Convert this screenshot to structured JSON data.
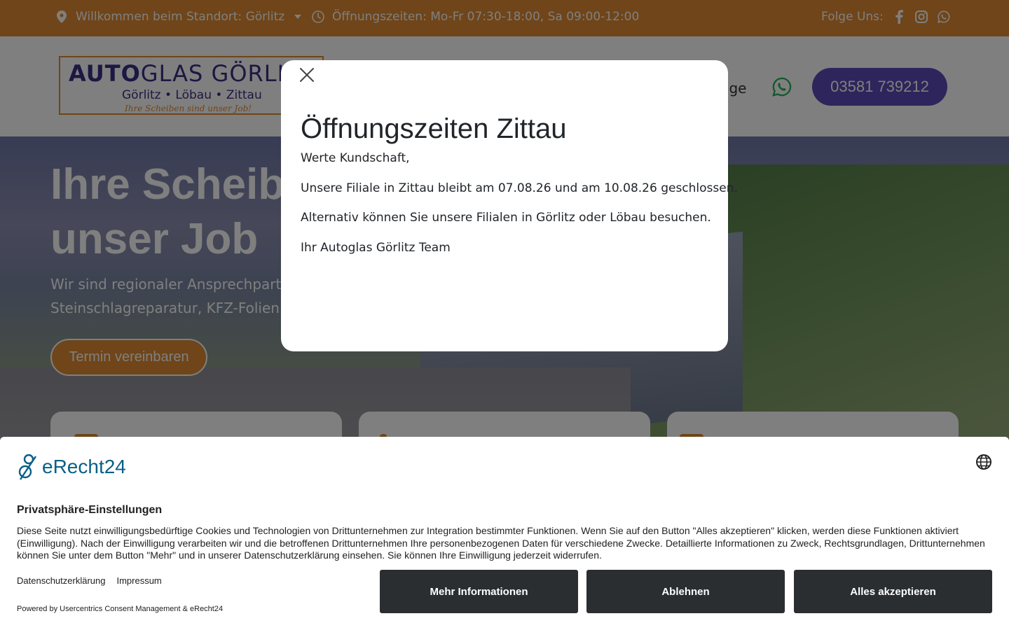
{
  "topbar": {
    "location_text": "Willkommen beim Standort: Görlitz",
    "hours_text": "Öffnungszeiten: Mo-Fr 07:30-18:00, Sa 09:00-12:00",
    "follow_label": "Folge Uns:",
    "social_icons": [
      "facebook-icon",
      "instagram-icon",
      "whatsapp-icon"
    ]
  },
  "header": {
    "logo": {
      "word_bold": "AUTO",
      "word_rest": "GLAS GÖRLITZ",
      "locations": "Görlitz • Löbau • Zittau",
      "slogan": "Ihre Scheiben sind unser Job!"
    },
    "nav_partial": "rage",
    "phone": "03581 739212"
  },
  "hero": {
    "title_line1": "Ihre Scheibe",
    "title_line2": "unser Job",
    "subtitle_line1": "Wir sind regionaler Ansprechpartne",
    "subtitle_line2": "Steinschlagreparatur, KFZ-Folien un",
    "cta": "Termin vereinbaren"
  },
  "modal": {
    "title": "Öffnungszeiten Zittau",
    "greeting": "Werte Kundschaft,",
    "line1": "Unsere Filiale in Zittau bleibt am 07.08.26 und am 10.08.26 geschlossen.",
    "line2": "Alternativ können Sie unsere Filialen in Görlitz oder Löbau besuchen.",
    "signature": "Ihr Autoglas Görlitz Team"
  },
  "consent": {
    "brand": "eRecht24",
    "heading": "Privatsphäre-Einstellungen",
    "description": "Diese Seite nutzt einwilligungsbedürftige Cookies und Technologien von Drittunternehmen zur Integration bestimmter Funktionen. Wenn Sie auf den Button \"Alles akzeptieren\" klicken, werden diese Funktionen aktiviert (Einwilligung). Nach der Einwilligung verarbeiten wir und die betroffenen Drittunternehmen Ihre personenbezogenen Daten für verschiedene Zwecke. Detaillierte Informationen zu Zweck, Rechtsgrundlagen, Drittunternehmen können Sie unter dem Button \"Mehr\" und in unserer Datenschutzerklärung einsehen. Sie können Ihre Einwilligung jederzeit widerrufen.",
    "link_privacy": "Datenschutzerklärung",
    "link_imprint": "Impressum",
    "powered": "Powered by Usercentrics Consent Management & eRecht24",
    "btn_more": "Mehr Informationen",
    "btn_decline": "Ablehnen",
    "btn_accept": "Alles akzeptieren"
  },
  "colors": {
    "topbar": "#de8a32",
    "brand_purple": "#5b4bb7",
    "consent_button": "#2b2e31",
    "erecht_blue": "#0a5f86"
  }
}
